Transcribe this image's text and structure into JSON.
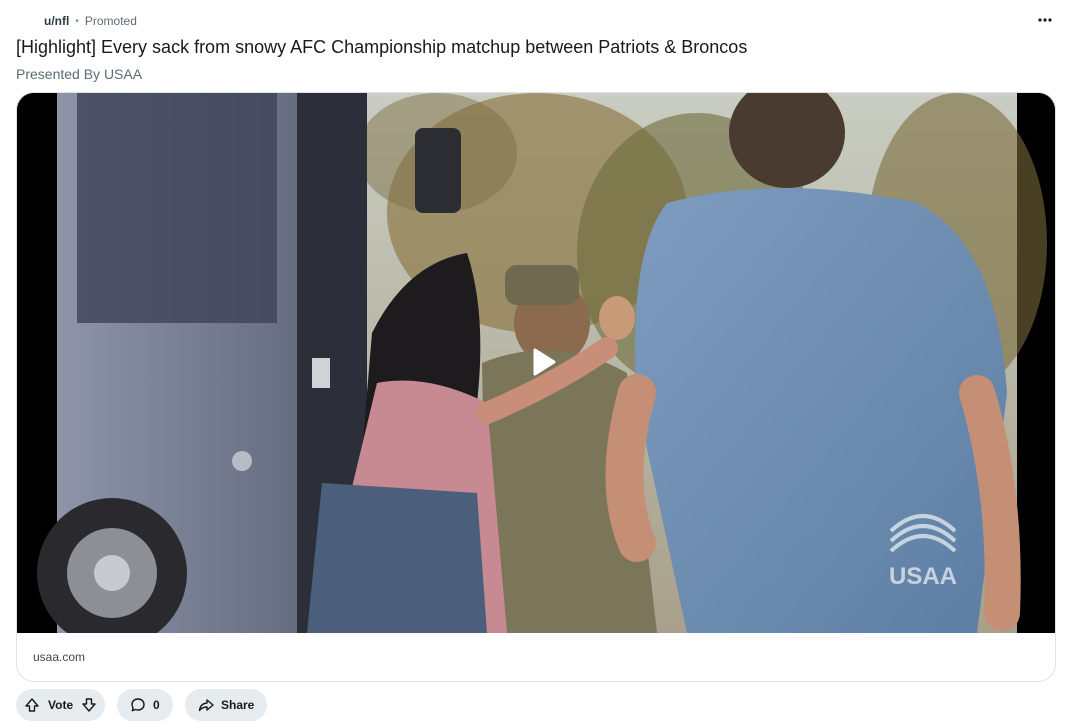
{
  "post": {
    "subreddit": "u/nfl",
    "separator": "•",
    "promoted_label": "Promoted",
    "title": "[Highlight] Every sack from snowy AFC Championship matchup between Patriots & Broncos",
    "presented_by": "Presented By USAA",
    "more_icon": "more-horizontal-icon"
  },
  "media": {
    "play_icon": "play-icon",
    "watermark": "USAA",
    "link_text": "usaa.com"
  },
  "actions": {
    "vote_label": "Vote",
    "comment_count": "0",
    "share_label": "Share",
    "upvote_icon": "arrow-up-icon",
    "downvote_icon": "arrow-down-icon",
    "comment_icon": "comment-bubble-icon",
    "share_icon": "share-arrow-icon"
  },
  "colors": {
    "pill_background": "#e5ebee",
    "text_primary": "#1a1a1b",
    "text_secondary": "#5c6c74"
  }
}
